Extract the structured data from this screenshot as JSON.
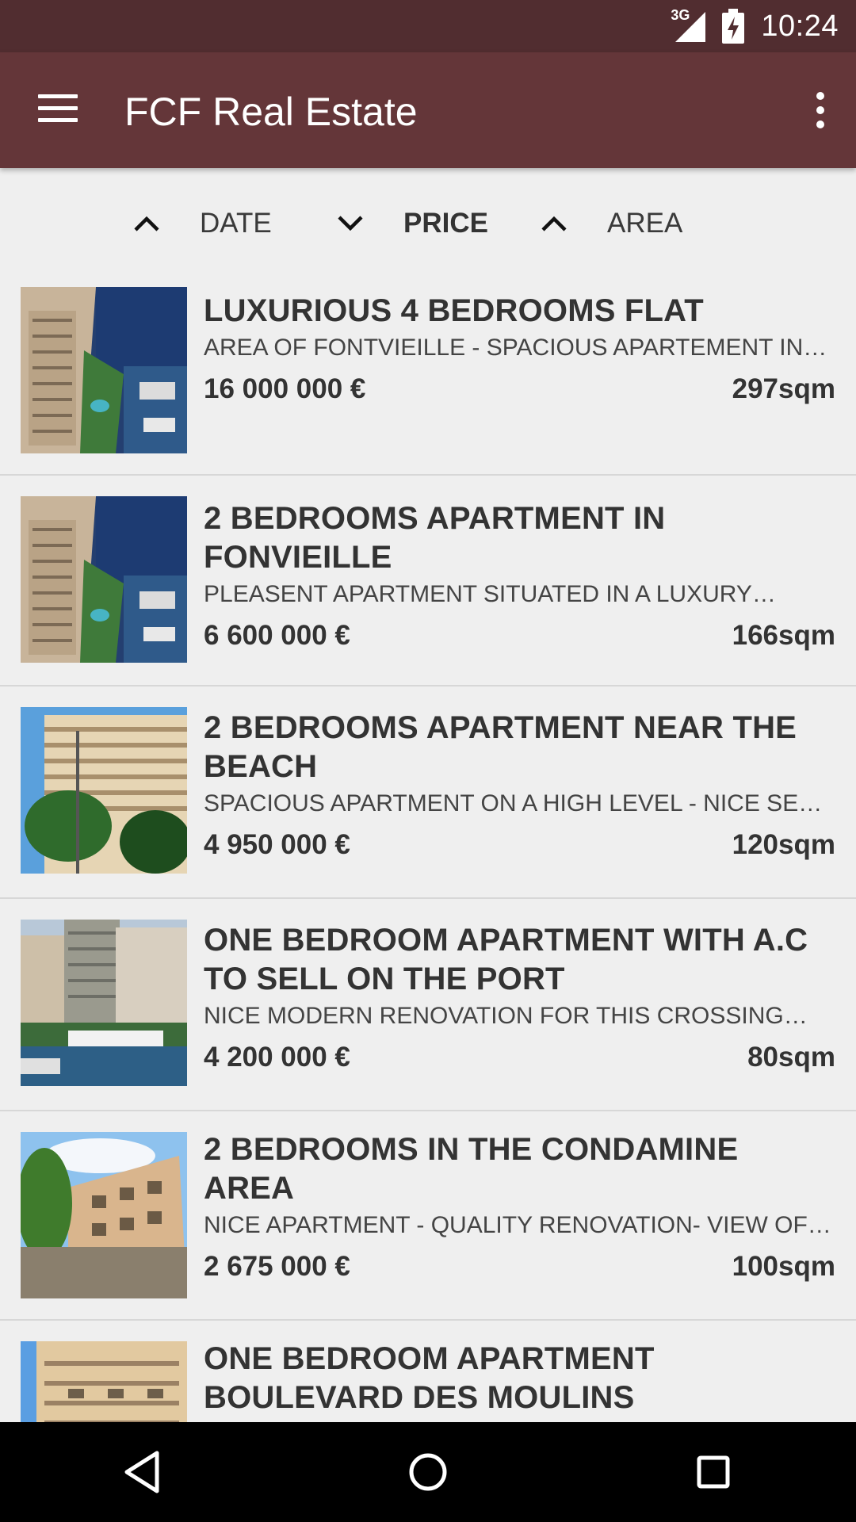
{
  "status": {
    "network": "3G",
    "time": "10:24"
  },
  "app": {
    "title": "FCF Real Estate"
  },
  "sort": {
    "date": {
      "label": "DATE",
      "direction": "up"
    },
    "price": {
      "label": "PRICE",
      "direction": "down",
      "active": true
    },
    "area": {
      "label": "AREA",
      "direction": "up"
    }
  },
  "listings": [
    {
      "title": "LUXURIOUS 4 BEDROOMS FLAT",
      "desc": "AREA OF FONTVIEILLE - SPACIOUS APARTEMENT IN…",
      "price": "16 000 000 €",
      "area": "297sqm",
      "image": "fontvieille-harbour-photo"
    },
    {
      "title": "2 BEDROOMS APARTMENT IN FONVIEILLE",
      "desc": "PLEASENT APARTMENT SITUATED IN A LUXURY…",
      "price": "6 600 000 €",
      "area": "166sqm",
      "image": "fontvieille-harbour-photo"
    },
    {
      "title": "2 BEDROOMS APARTMENT NEAR THE BEACH",
      "desc": "SPACIOUS APARTMENT ON A HIGH LEVEL - NICE SEA…",
      "price": "4 950 000 €",
      "area": "120sqm",
      "image": "tower-block-photo"
    },
    {
      "title": "ONE BEDROOM APARTMENT WITH A.C TO SELL ON THE PORT",
      "desc": "NICE MODERN RENOVATION FOR THIS CROSSING…",
      "price": "4 200 000 €",
      "area": "80sqm",
      "image": "port-skyline-photo"
    },
    {
      "title": "2 BEDROOMS IN THE CONDAMINE AREA",
      "desc": "NICE APARTMENT - QUALITY RENOVATION- VIEW OF…",
      "price": "2 675 000 €",
      "area": "100sqm",
      "image": "condamine-building-photo"
    },
    {
      "title": "ONE BEDROOM APARTMENT BOULEVARD DES MOULINS",
      "desc": "",
      "price": "",
      "area": "",
      "image": "boulevard-building-photo"
    }
  ],
  "colors": {
    "status_bar": "#512d30",
    "app_bar": "#643639",
    "background": "#efefef"
  }
}
